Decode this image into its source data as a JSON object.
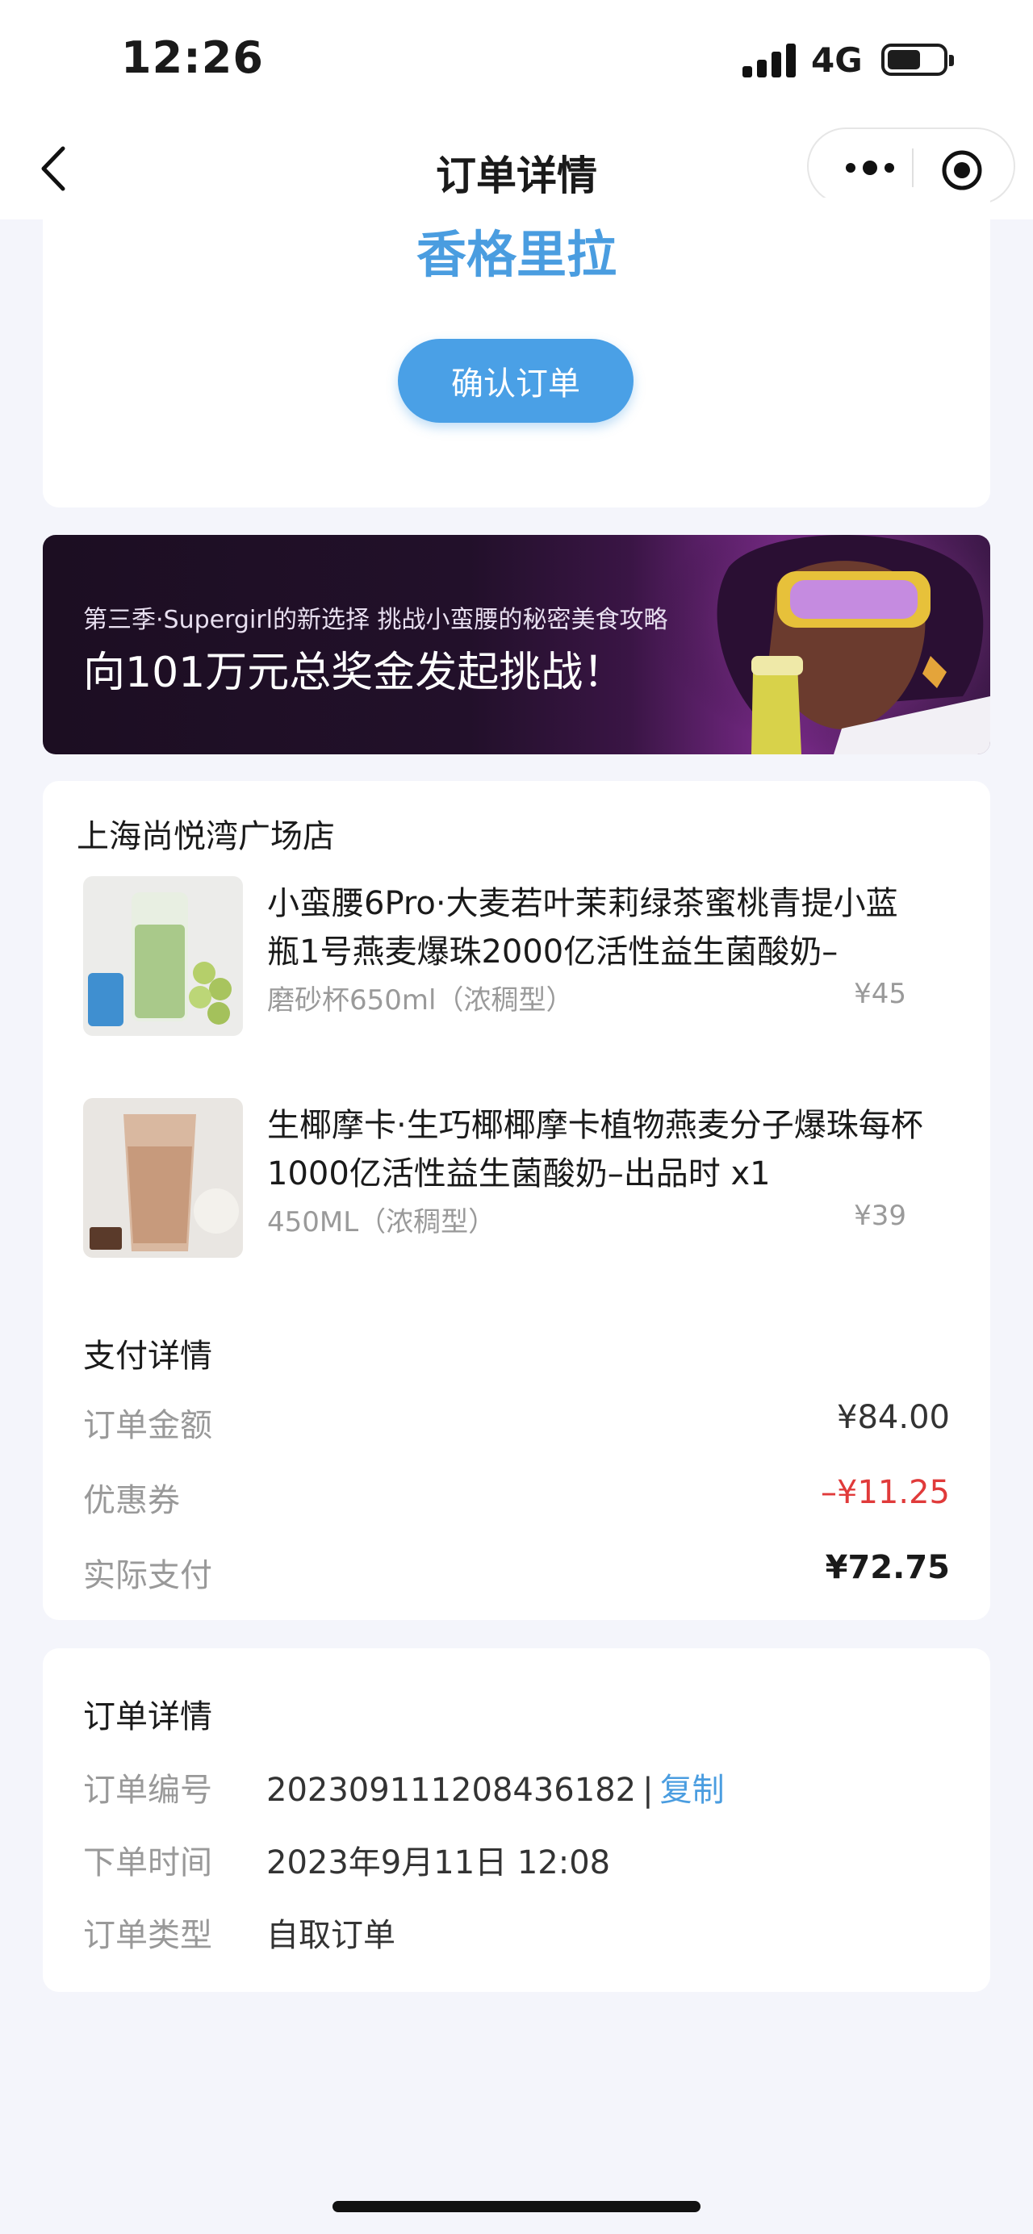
{
  "status_bar": {
    "time": "12:26",
    "network": "4G",
    "battery_level": 0.6
  },
  "nav": {
    "title": "订单详情",
    "back_icon": "chevron-left-icon",
    "more_icon": "more-dots-icon",
    "close_icon": "target-icon"
  },
  "top_card": {
    "store_name": "香格里拉",
    "confirm_button": "确认订单"
  },
  "banner": {
    "subtitle": "第三季·Supergirl的新选择 挑战小蛮腰的秘密美食攻略",
    "headline": "向101万元总奖金发起挑战！"
  },
  "order": {
    "shop_name": "上海尚悦湾广场店",
    "items": [
      {
        "name": "小蛮腰6Pro·大麦若叶茉莉绿茶蜜桃青提小蓝瓶1号燕麦爆珠2000亿活性益生菌酸奶–",
        "spec": "磨砂杯650ml（浓稠型）",
        "price": "¥45"
      },
      {
        "name": "生椰摩卡·生巧椰椰摩卡植物燕麦分子爆珠每杯1000亿活性益生菌酸奶–出品时 x1",
        "spec": "450ML（浓稠型）",
        "price": "¥39"
      }
    ]
  },
  "payment": {
    "title": "支付详情",
    "rows": [
      {
        "label": "订单金额",
        "value": "¥84.00"
      },
      {
        "label": "优惠券",
        "value": "–¥11.25"
      },
      {
        "label": "实际支付",
        "value": "¥72.75"
      }
    ]
  },
  "details": {
    "title": "订单详情",
    "order_no_label": "订单编号",
    "order_no": "20230911120843618 2",
    "copy": "复制",
    "time_label": "下单时间",
    "time": "2023年9月11日 12:08",
    "type_label": "订单类型",
    "type": "自取订单"
  },
  "colors": {
    "accent": "#4a9de0",
    "discount": "#e03a3a",
    "background": "#f4f5fb"
  }
}
